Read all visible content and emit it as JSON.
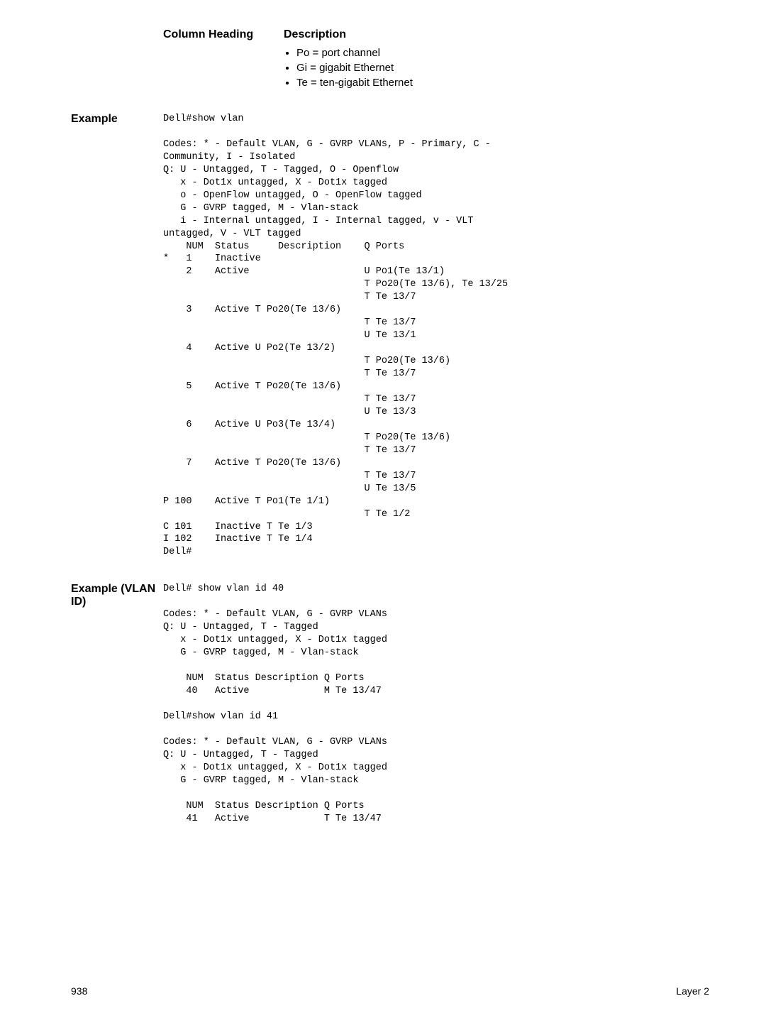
{
  "table": {
    "head_col": "Column Heading",
    "head_desc": "Description",
    "bullets": [
      "Po = port channel",
      "Gi = gigabit Ethernet",
      "Te = ten-gigabit Ethernet"
    ]
  },
  "example1": {
    "label": "Example",
    "code": "Dell#show vlan\n\nCodes: * - Default VLAN, G - GVRP VLANs, P - Primary, C - \nCommunity, I - Isolated\nQ: U - Untagged, T - Tagged, O - Openflow\n   x - Dot1x untagged, X - Dot1x tagged\n   o - OpenFlow untagged, O - OpenFlow tagged\n   G - GVRP tagged, M - Vlan-stack\n   i - Internal untagged, I - Internal tagged, v - VLT \nuntagged, V - VLT tagged\n    NUM  Status     Description    Q Ports\n*   1    Inactive\n    2    Active                    U Po1(Te 13/1)\n                                   T Po20(Te 13/6), Te 13/25\n                                   T Te 13/7\n    3    Active T Po20(Te 13/6)\n                                   T Te 13/7\n                                   U Te 13/1\n    4    Active U Po2(Te 13/2)\n                                   T Po20(Te 13/6)\n                                   T Te 13/7\n    5    Active T Po20(Te 13/6)\n                                   T Te 13/7\n                                   U Te 13/3\n    6    Active U Po3(Te 13/4)\n                                   T Po20(Te 13/6)\n                                   T Te 13/7\n    7    Active T Po20(Te 13/6)\n                                   T Te 13/7\n                                   U Te 13/5\nP 100    Active T Po1(Te 1/1)\n                                   T Te 1/2\nC 101    Inactive T Te 1/3\nI 102    Inactive T Te 1/4\nDell#"
  },
  "example2": {
    "label": "Example (VLAN ID)",
    "code": "Dell# show vlan id 40\n\nCodes: * - Default VLAN, G - GVRP VLANs\nQ: U - Untagged, T - Tagged\n   x - Dot1x untagged, X - Dot1x tagged\n   G - GVRP tagged, M - Vlan-stack\n\n    NUM  Status Description Q Ports\n    40   Active             M Te 13/47\n\nDell#show vlan id 41\n\nCodes: * - Default VLAN, G - GVRP VLANs\nQ: U - Untagged, T - Tagged\n   x - Dot1x untagged, X - Dot1x tagged\n   G - GVRP tagged, M - Vlan-stack\n\n    NUM  Status Description Q Ports\n    41   Active             T Te 13/47"
  },
  "footer": {
    "page_num": "938",
    "section": "Layer 2"
  }
}
